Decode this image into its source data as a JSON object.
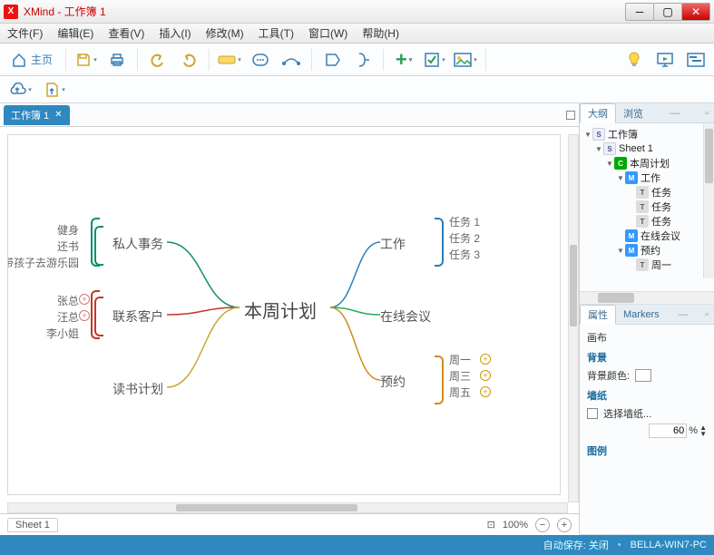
{
  "window": {
    "title": "XMind - 工作簿 1"
  },
  "menu": [
    "文件(F)",
    "编辑(E)",
    "查看(V)",
    "插入(I)",
    "修改(M)",
    "工具(T)",
    "窗口(W)",
    "帮助(H)"
  ],
  "toolbar": {
    "home_label": "主页"
  },
  "tab": {
    "label": "工作簿 1"
  },
  "mindmap": {
    "center": "本周计划",
    "left": [
      {
        "label": "私人事务",
        "children": [
          "健身",
          "还书",
          "带孩子去游乐园"
        ],
        "childHasPlus": false,
        "color": "#0a8f6d"
      },
      {
        "label": "联系客户",
        "children": [
          "张总",
          "汪总",
          "李小姐"
        ],
        "childHasPlus": true,
        "color": "#c0392b"
      },
      {
        "label": "读书计划",
        "children": [],
        "plusBefore": true,
        "color": "#c8a836"
      }
    ],
    "right": [
      {
        "label": "工作",
        "children": [
          "任务 1",
          "任务 2",
          "任务 3"
        ],
        "childHasPlus": false,
        "color": "#2a7fb8"
      },
      {
        "label": "在线会议",
        "children": [],
        "color": "#1fae5a"
      },
      {
        "label": "预约",
        "children": [
          "周一",
          "周三",
          "周五"
        ],
        "childHasPlus": true,
        "color": "#d38b1b"
      }
    ]
  },
  "rightPanel": {
    "tabs": [
      "大纲",
      "浏览"
    ],
    "tree": [
      {
        "indent": 0,
        "tw": "▼",
        "icon": "S",
        "label": "工作簿"
      },
      {
        "indent": 1,
        "tw": "▼",
        "icon": "S",
        "label": "Sheet 1"
      },
      {
        "indent": 2,
        "tw": "▼",
        "icon": "C",
        "label": "本周计划"
      },
      {
        "indent": 3,
        "tw": "▼",
        "icon": "M",
        "label": "工作"
      },
      {
        "indent": 4,
        "tw": "",
        "icon": "T",
        "label": "任务"
      },
      {
        "indent": 4,
        "tw": "",
        "icon": "T",
        "label": "任务"
      },
      {
        "indent": 4,
        "tw": "",
        "icon": "T",
        "label": "任务"
      },
      {
        "indent": 3,
        "tw": "",
        "icon": "M",
        "label": "在线会议"
      },
      {
        "indent": 3,
        "tw": "▼",
        "icon": "M",
        "label": "预约"
      },
      {
        "indent": 4,
        "tw": "",
        "icon": "T",
        "label": "周一"
      }
    ],
    "propTabs": [
      "属性",
      "Markers"
    ],
    "canvasLabel": "画布",
    "bgGroup": "背景",
    "bgColorLabel": "背景颜色:",
    "wallGroup": "墙纸",
    "wallSelect": "选择墙纸...",
    "opacity": "60",
    "pct": "%",
    "legendGroup": "图例"
  },
  "bottom": {
    "sheet": "Sheet 1",
    "zoomIcon": "⊡",
    "zoom": "100%"
  },
  "status": {
    "autosave": "自动保存: 关闭",
    "host": "BELLA-WIN7-PC"
  }
}
